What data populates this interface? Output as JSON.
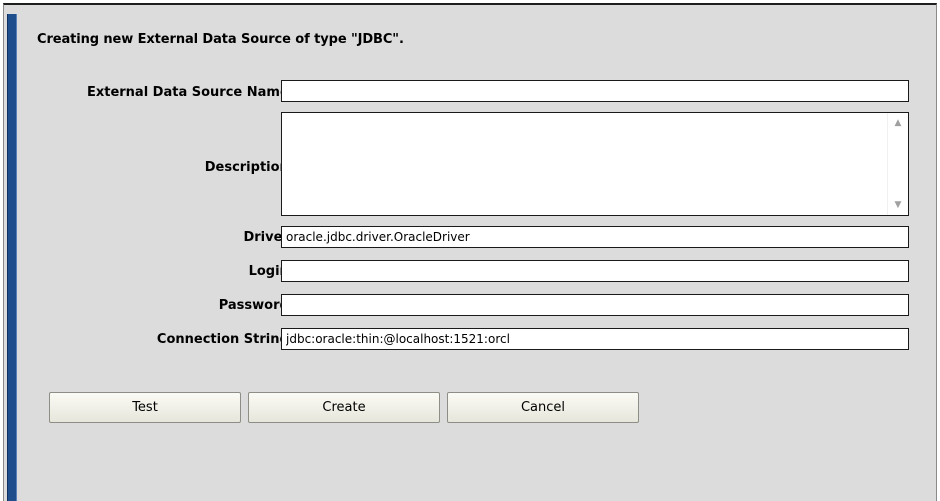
{
  "dialog": {
    "heading": "Creating new External Data Source of type \"JDBC\"."
  },
  "form": {
    "name_label": "External Data Source Name:",
    "name_value": "",
    "description_label": "Description:",
    "description_value": "",
    "driver_label": "Driver:",
    "driver_value": "oracle.jdbc.driver.OracleDriver",
    "login_label": "Login:",
    "login_value": "",
    "password_label": "Password:",
    "password_value": "",
    "connection_label": "Connection String:",
    "connection_value": "jdbc:oracle:thin:@localhost:1521:orcl"
  },
  "buttons": {
    "test": "Test",
    "create": "Create",
    "cancel": "Cancel"
  },
  "icons": {
    "scroll_up": "scroll-up-arrow-icon",
    "scroll_down": "scroll-down-arrow-icon"
  },
  "colors": {
    "accent_bar": "#1e4e8c",
    "panel_bg": "#dcdcdc"
  }
}
